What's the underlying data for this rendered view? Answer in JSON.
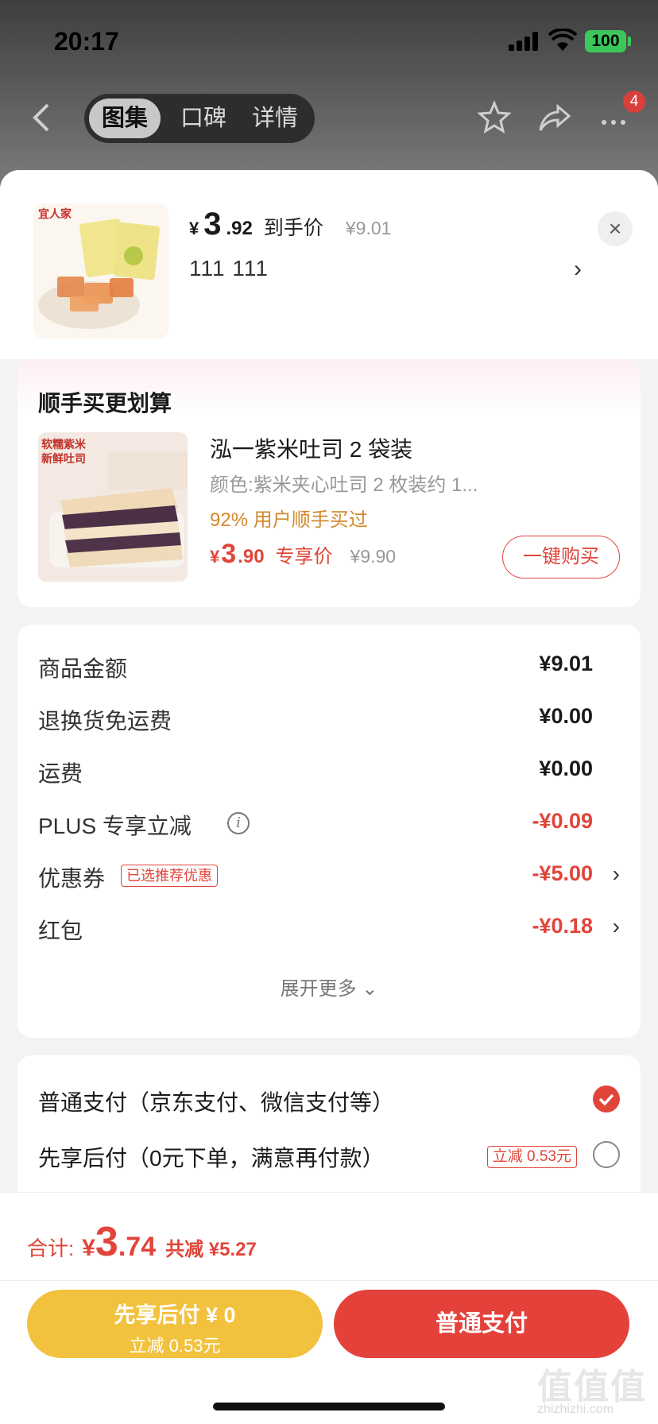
{
  "status": {
    "time": "20:17",
    "battery": "100"
  },
  "nav": {
    "tabs": [
      {
        "label": "图集",
        "active": true
      },
      {
        "label": "口碑",
        "active": false
      },
      {
        "label": "详情",
        "active": false
      }
    ],
    "more_badge": "4"
  },
  "product": {
    "yen": "¥",
    "price_int": "3",
    "price_dec": ".92",
    "price_label": "到手价",
    "original_price": "¥9.01",
    "spec": "111  111",
    "close": "×",
    "spec_arrow": "›"
  },
  "recommend": {
    "title": "顺手买更划算",
    "item": {
      "name": "泓一紫米吐司 2 袋装",
      "attr": "颜色:紫米夹心吐司 2 枚装约 1...",
      "pct": "92% 用户顺手买过",
      "yen": "¥",
      "price_int": "3",
      "price_dec": ".90",
      "price_label": "专享价",
      "original_price": "¥9.90",
      "buy_label": "一键购买",
      "image_text": [
        "软糯紫米",
        "新鲜吐司"
      ]
    }
  },
  "costs": [
    {
      "label": "商品金额",
      "value": "¥9.01",
      "red": false
    },
    {
      "label": "退换货免运费",
      "value": "¥0.00",
      "red": false
    },
    {
      "label": "运费",
      "value": "¥0.00",
      "red": false
    },
    {
      "label": "PLUS 专享立减",
      "value": "-¥0.09",
      "red": true,
      "info": "i"
    },
    {
      "label": "优惠券",
      "value": "-¥5.00",
      "red": true,
      "tag": "已选推荐优惠",
      "arrow": "›"
    },
    {
      "label": "红包",
      "value": "-¥0.18",
      "red": true,
      "arrow": "›"
    }
  ],
  "expand_label": "展开更多 ⌄",
  "payments": [
    {
      "label": "普通支付（京东支付、微信支付等）",
      "selected": true
    },
    {
      "label": "先享后付（0元下单，满意再付款）",
      "selected": false,
      "tag": "立减 0.53元"
    }
  ],
  "footer": {
    "total_label": "合计:",
    "yen": "¥",
    "total_int": "3",
    "total_dec": ".74",
    "save": "共减 ¥5.27",
    "later_line1": "先享后付 ¥ 0",
    "later_line2": "立减 0.53元",
    "normal_label": "普通支付"
  },
  "watermark": {
    "main": "值值值",
    "sub": "zhizhizhi.com"
  },
  "colors": {
    "accent": "#e1453a",
    "later_btn": "#f2c23e",
    "orange_text": "#d2892c"
  }
}
